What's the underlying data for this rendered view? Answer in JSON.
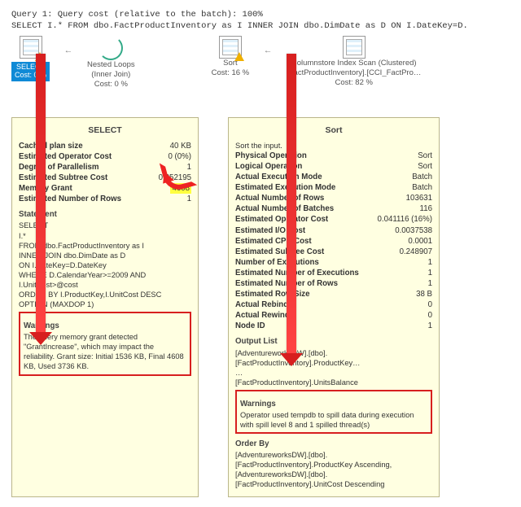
{
  "query": {
    "line1": "Query 1: Query cost (relative to the batch): 100%",
    "line2": "SELECT I.* FROM dbo.FactProductInventory as I INNER JOIN dbo.DimDate as D ON I.DateKey=D."
  },
  "plan": {
    "select": {
      "name": "SELECT",
      "cost": "Cost: 0 %"
    },
    "nested": {
      "name": "Nested Loops",
      "sub": "(Inner Join)",
      "cost": "Cost: 0 %"
    },
    "sort": {
      "name": "Sort",
      "cost": "Cost: 16 %"
    },
    "scan": {
      "name": "Columnstore Index Scan (Clustered)",
      "sub": "[FactProductInventory].[CCI_FactPro…",
      "cost": "Cost: 82 %"
    },
    "arrow": "←"
  },
  "tipA": {
    "title": "SELECT",
    "rows": [
      {
        "k": "Cached plan size",
        "v": "40 KB"
      },
      {
        "k": "Estimated Operator Cost",
        "v": "0 (0%)"
      },
      {
        "k": "Degree of Parallelism",
        "v": "1"
      },
      {
        "k": "Estimated Subtree Cost",
        "v": "0.252195"
      },
      {
        "k": "Memory Grant",
        "v": "4608"
      },
      {
        "k": "Estimated Number of Rows",
        "v": "1"
      }
    ],
    "stmt_h": "Statement",
    "stmt": "SELECT\nI.*\nFROM dbo.FactProductInventory as I\nINNER JOIN dbo.DimDate as D\nON I.DateKey=D.DateKey\nWHERE D.CalendarYear>=2009 AND\nI.UnitCost>@cost\nORDER BY I.ProductKey,I.UnitCost DESC\nOPTION (MAXDOP 1)",
    "warn_h": "Warnings",
    "warn": "The query memory grant detected \"GrantIncrease\", which may impact the reliability. Grant size: Initial 1536 KB, Final 4608 KB, Used 3736 KB."
  },
  "tipB": {
    "title": "Sort",
    "subtitle": "Sort the input.",
    "rows": [
      {
        "k": "Physical Operation",
        "v": "Sort"
      },
      {
        "k": "Logical Operation",
        "v": "Sort"
      },
      {
        "k": "Actual Execution Mode",
        "v": "Batch"
      },
      {
        "k": "Estimated Execution Mode",
        "v": "Batch"
      },
      {
        "k": "Actual Number of Rows",
        "v": "103631"
      },
      {
        "k": "Actual Number of Batches",
        "v": "116"
      },
      {
        "k": "Estimated Operator Cost",
        "v": "0.041116 (16%)"
      },
      {
        "k": "Estimated I/O Cost",
        "v": "0.0037538"
      },
      {
        "k": "Estimated CPU Cost",
        "v": "0.0001"
      },
      {
        "k": "Estimated Subtree Cost",
        "v": "0.248907"
      },
      {
        "k": "Number of Executions",
        "v": "1"
      },
      {
        "k": "Estimated Number of Executions",
        "v": "1"
      },
      {
        "k": "Estimated Number of Rows",
        "v": "1"
      },
      {
        "k": "Estimated Row Size",
        "v": "38 B"
      },
      {
        "k": "Actual Rebinds",
        "v": "0"
      },
      {
        "k": "Actual Rewinds",
        "v": "0"
      },
      {
        "k": "Node ID",
        "v": "1"
      }
    ],
    "out_h": "Output List",
    "out": "[AdventureworksDW].[dbo].\n[FactProductInventory].ProductKey…\n…\n[FactProductInventory].UnitsBalance",
    "warn_h": "Warnings",
    "warn": "Operator used tempdb to spill data during execution with spill level 8 and 1 spilled thread(s)",
    "order_h": "Order By",
    "order": "[AdventureworksDW].[dbo].\n[FactProductInventory].ProductKey Ascending,\n[AdventureworksDW].[dbo].\n[FactProductInventory].UnitCost Descending"
  }
}
